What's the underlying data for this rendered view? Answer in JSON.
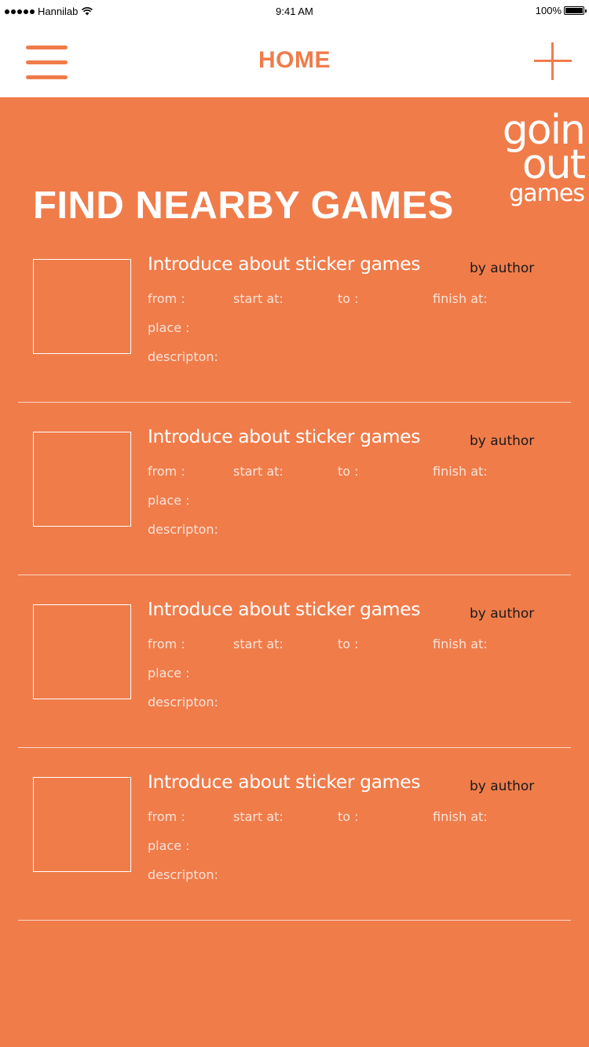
{
  "status_bar": {
    "carrier": "Hannilab",
    "time": "9:41 AM",
    "battery": "100%",
    "battery_level": 1.0
  },
  "nav": {
    "title": "HOME",
    "menu_icon": "hamburger-menu-icon",
    "add_icon": "plus-icon"
  },
  "logo": {
    "line1": "goin",
    "line2": "out",
    "line3": "games"
  },
  "heading": "FIND NEARBY GAMES",
  "games": [
    {
      "title": "Introduce about sticker games",
      "author": "by author",
      "from_label": "from :",
      "start_label": "start at:",
      "to_label": "to :",
      "finish_label": "finish at:",
      "place_label": "place :",
      "description_label": "descripton:"
    },
    {
      "title": "Introduce about sticker games",
      "author": "by author",
      "from_label": "from :",
      "start_label": "start at:",
      "to_label": "to :",
      "finish_label": "finish at:",
      "place_label": "place :",
      "description_label": "descripton:"
    },
    {
      "title": "Introduce about sticker games",
      "author": "by author",
      "from_label": "from :",
      "start_label": "start at:",
      "to_label": "to :",
      "finish_label": "finish at:",
      "place_label": "place :",
      "description_label": "descripton:"
    },
    {
      "title": "Introduce about sticker games",
      "author": "by author",
      "from_label": "from :",
      "start_label": "start at:",
      "to_label": "to :",
      "finish_label": "finish at:",
      "place_label": "place :",
      "description_label": "descripton:"
    }
  ],
  "colors": {
    "accent": "#f07c4a",
    "background": "#f07c4a",
    "header_bg": "#ffffff",
    "text_light": "#ffffff",
    "text_dark": "#1a1a1a"
  }
}
